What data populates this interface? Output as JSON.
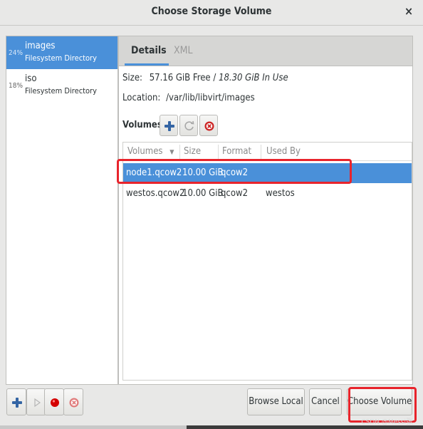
{
  "window": {
    "title": "Choose Storage Volume",
    "close_glyph": "×"
  },
  "pools": [
    {
      "percent": "24%",
      "name": "images",
      "type": "Filesystem Directory",
      "selected": true
    },
    {
      "percent": "18%",
      "name": "iso",
      "type": "Filesystem Directory",
      "selected": false
    }
  ],
  "tabs": {
    "details": "Details",
    "xml": "XML"
  },
  "details": {
    "size_label": "Size:",
    "size_free": "57.16 GiB Free /",
    "size_used": "18.30 GiB In Use",
    "location_label": "Location:",
    "location_value": "/var/lib/libvirt/images",
    "volumes_label": "Volumes"
  },
  "volume_table": {
    "headers": [
      "Volumes",
      "Size",
      "Format",
      "Used By"
    ],
    "sort_glyph": "▼",
    "rows": [
      {
        "name": "node1.qcow2",
        "size": "10.00 GiB",
        "format": "qcow2",
        "used_by": "",
        "selected": true
      },
      {
        "name": "westos.qcow2",
        "size": "10.00 GiB",
        "format": "qcow2",
        "used_by": "westos",
        "selected": false
      }
    ]
  },
  "buttons": {
    "browse_local": "Browse Local",
    "cancel": "Cancel",
    "choose_volume": "Choose Volume"
  },
  "watermark": "CSDN @Messi张",
  "colors": {
    "selection": "#4a90d9",
    "annotation_red": "#e8242c"
  },
  "icons": [
    "add-icon",
    "refresh-icon",
    "delete-icon",
    "play-icon",
    "stop-icon"
  ]
}
